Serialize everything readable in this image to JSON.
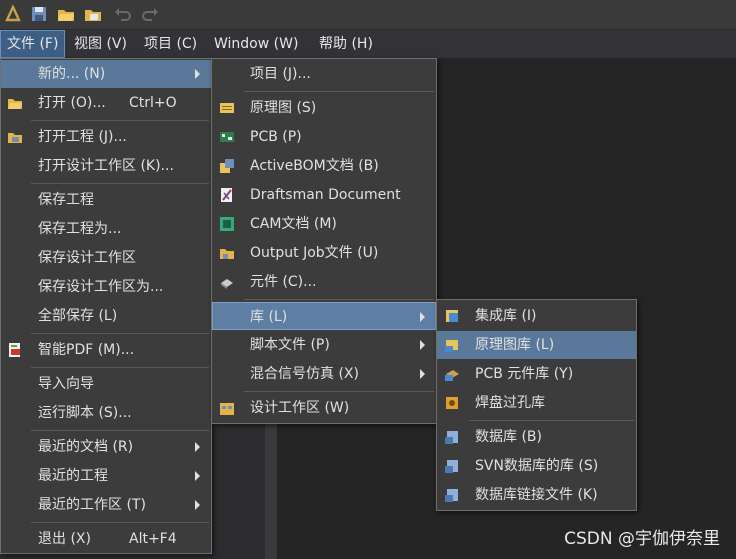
{
  "menubar": {
    "items": [
      {
        "label": "文件 (F)"
      },
      {
        "label": "视图 (V)"
      },
      {
        "label": "项目 (C)"
      },
      {
        "label": "Window (W)"
      },
      {
        "label": "帮助 (H)"
      }
    ]
  },
  "file_menu": {
    "new": "新的... (N)",
    "open": "打开 (O)...",
    "open_sc": "Ctrl+O",
    "open_project": "打开工程 (J)...",
    "open_workspace": "打开设计工作区 (K)...",
    "save_project": "保存工程",
    "save_project_as": "保存工程为...",
    "save_workspace": "保存设计工作区",
    "save_workspace_as": "保存设计工作区为...",
    "save_all": "全部保存 (L)",
    "smart_pdf": "智能PDF (M)...",
    "import_wizard": "导入向导",
    "run_script": "运行脚本 (S)...",
    "recent_docs": "最近的文档 (R)",
    "recent_projects": "最近的工程",
    "recent_workspaces": "最近的工作区 (T)",
    "exit": "退出 (X)",
    "exit_sc": "Alt+F4"
  },
  "new_menu": {
    "project": "项目 (J)...",
    "schematic": "原理图 (S)",
    "pcb": "PCB (P)",
    "activebom": "ActiveBOM文档 (B)",
    "draftsman": "Draftsman Document",
    "cam": "CAM文档 (M)",
    "output_job": "Output Job文件 (U)",
    "component": "元件 (C)...",
    "library": "库 (L)",
    "script_file": "脚本文件 (P)",
    "mixed_sim": "混合信号仿真 (X)",
    "workspace": "设计工作区 (W)"
  },
  "library_menu": {
    "integrated": "集成库 (I)",
    "schlib": "原理图库 (L)",
    "pcblib": "PCB 元件库 (Y)",
    "padvia": "焊盘过孔库",
    "database": "数据库 (B)",
    "svn_database": "SVN数据库的库 (S)",
    "db_link": "数据库链接文件 (K)"
  },
  "watermark": "CSDN @宇伽伊奈里"
}
